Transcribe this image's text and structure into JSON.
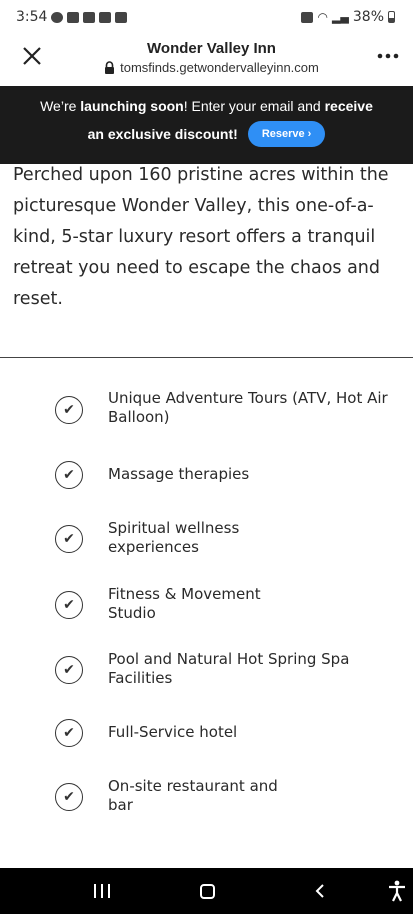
{
  "status_bar": {
    "time": "3:54",
    "battery": "38%"
  },
  "browser": {
    "site_title": "Wonder Valley Inn",
    "url": "tomsfinds.getwondervalleyinn.com",
    "close_icon": "close-icon",
    "more_icon": "more-icon",
    "lock_icon": "lock-icon"
  },
  "promo": {
    "line1_part1": "We’re ",
    "line1_bold1": "launching soon",
    "line1_part2": "! Enter your email and ",
    "line1_bold2": "receive",
    "line2_bold": "an exclusive discount!",
    "reserve_label": "Reserve ›",
    "accent_color": "#2f8ff5",
    "background_color": "#1b1b1b"
  },
  "intro": {
    "text": "Perched upon 160 pristine acres within the picturesque Wonder Valley, this one-of-a-kind, 5-star luxury resort offers a tranquil retreat you need to escape the chaos and reset."
  },
  "features": {
    "items": [
      {
        "label": "Unique Adventure Tours (ATV, Hot Air Balloon)"
      },
      {
        "label": "Massage therapies"
      },
      {
        "label": "Spiritual wellness experiences"
      },
      {
        "label": "Fitness & Movement Studio"
      },
      {
        "label": "Pool and Natural Hot Spring Spa Facilities"
      },
      {
        "label": "Full-Service hotel"
      },
      {
        "label": "On-site restaurant and bar"
      }
    ]
  },
  "nav_bar": {
    "recents_icon": "recents-icon",
    "home_icon": "home-icon",
    "back_icon": "back-icon",
    "accessibility_icon": "accessibility-icon"
  }
}
